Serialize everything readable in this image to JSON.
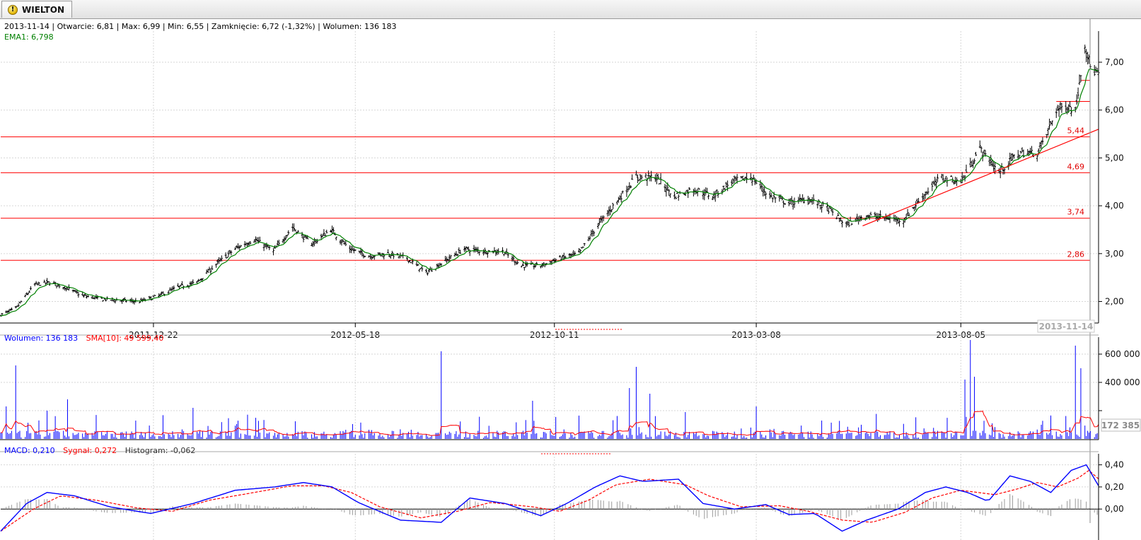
{
  "tab": {
    "title": "WIELTON",
    "icon": "warning-icon"
  },
  "header": {
    "quote": "2013-11-14 | Otwarcie: 6,81 | Max: 6,99 | Min: 6,55 | Zamknięcie: 6,72 (-1,32%)   | Wolumen: 136 183",
    "ema": "EMA1: 6,798"
  },
  "volume_panel": {
    "label": "Wolumen: 136 183",
    "sma": "SMA[10]: 49 599,40",
    "marker": "172 385"
  },
  "macd_panel": {
    "macd": "MACD: 0,210",
    "signal": "Sygnał: 0,272",
    "histogram": "Histogram: -0,062"
  },
  "colors": {
    "price_bar": "#000000",
    "ema": "#008000",
    "level_line": "#ff0000",
    "volume_bar": "#0000ff",
    "sma": "#ff0000",
    "macd": "#0000ff",
    "signal": "#ff0000",
    "histogram": "#9a9a9a"
  },
  "chart_data": [
    {
      "type": "ohlc",
      "title": "",
      "x_tick_labels": [
        "2011-12-22",
        "2012-05-18",
        "2012-10-11",
        "2013-03-08",
        "2013-08-05"
      ],
      "cursor_date": "2013-11-14",
      "y_ticks": [
        2.0,
        3.0,
        4.0,
        5.0,
        6.0,
        7.0
      ],
      "y_tick_labels": [
        "2,00",
        "3,00",
        "4,00",
        "5,00",
        "6,00",
        "7,00"
      ],
      "ylim": [
        1.55,
        7.65
      ],
      "x_range": [
        "2011-09-01",
        "2013-11-14"
      ],
      "close_path": [
        [
          "2011-09-01",
          1.72
        ],
        [
          "2011-09-12",
          1.85
        ],
        [
          "2011-09-26",
          2.35
        ],
        [
          "2011-10-07",
          2.4
        ],
        [
          "2011-10-18",
          2.3
        ],
        [
          "2011-10-31",
          2.12
        ],
        [
          "2011-11-14",
          2.05
        ],
        [
          "2011-11-28",
          2.02
        ],
        [
          "2011-12-12",
          2.0
        ],
        [
          "2011-12-26",
          2.12
        ],
        [
          "2012-01-09",
          2.3
        ],
        [
          "2012-01-23",
          2.4
        ],
        [
          "2012-02-06",
          2.78
        ],
        [
          "2012-02-20",
          3.1
        ],
        [
          "2012-03-05",
          3.3
        ],
        [
          "2012-03-19",
          3.05
        ],
        [
          "2012-04-02",
          3.55
        ],
        [
          "2012-04-16",
          3.2
        ],
        [
          "2012-04-30",
          3.5
        ],
        [
          "2012-05-14",
          3.1
        ],
        [
          "2012-05-28",
          2.95
        ],
        [
          "2012-06-11",
          3.0
        ],
        [
          "2012-06-25",
          2.9
        ],
        [
          "2012-07-09",
          2.6
        ],
        [
          "2012-07-23",
          2.85
        ],
        [
          "2012-08-06",
          3.1
        ],
        [
          "2012-08-20",
          3.05
        ],
        [
          "2012-09-03",
          3.05
        ],
        [
          "2012-09-17",
          2.75
        ],
        [
          "2012-10-01",
          2.75
        ],
        [
          "2012-10-15",
          2.9
        ],
        [
          "2012-10-29",
          3.0
        ],
        [
          "2012-11-12",
          3.6
        ],
        [
          "2012-11-26",
          4.1
        ],
        [
          "2012-12-10",
          4.6
        ],
        [
          "2012-12-24",
          4.6
        ],
        [
          "2013-01-07",
          4.2
        ],
        [
          "2013-01-21",
          4.35
        ],
        [
          "2013-02-04",
          4.2
        ],
        [
          "2013-02-18",
          4.5
        ],
        [
          "2013-03-04",
          4.6
        ],
        [
          "2013-03-18",
          4.2
        ],
        [
          "2013-04-01",
          4.05
        ],
        [
          "2013-04-15",
          4.15
        ],
        [
          "2013-04-29",
          3.95
        ],
        [
          "2013-05-13",
          3.6
        ],
        [
          "2013-05-27",
          3.8
        ],
        [
          "2013-06-10",
          3.75
        ],
        [
          "2013-06-24",
          3.7
        ],
        [
          "2013-07-08",
          4.2
        ],
        [
          "2013-07-22",
          4.6
        ],
        [
          "2013-08-05",
          4.5
        ],
        [
          "2013-08-19",
          5.2
        ],
        [
          "2013-09-02",
          4.7
        ],
        [
          "2013-09-16",
          5.1
        ],
        [
          "2013-09-30",
          5.1
        ],
        [
          "2013-10-07",
          5.5
        ],
        [
          "2013-10-14",
          6.0
        ],
        [
          "2013-10-21",
          6.1
        ],
        [
          "2013-10-28",
          6.0
        ],
        [
          "2013-11-04",
          7.4
        ],
        [
          "2013-11-08",
          6.9
        ],
        [
          "2013-11-14",
          6.72
        ]
      ],
      "ema_label": "EMA1: 6,798",
      "horizontal_levels": [
        {
          "value": 2.86,
          "label": "2,86"
        },
        {
          "value": 3.74,
          "label": "3,74"
        },
        {
          "value": 4.69,
          "label": "4,69"
        },
        {
          "value": 5.44,
          "label": "5,44"
        },
        {
          "value": 6.18,
          "label": ""
        },
        {
          "value": 6.62,
          "label": ""
        }
      ],
      "trendline": [
        [
          "2013-05-25",
          3.58
        ],
        [
          "2013-11-14",
          5.6
        ]
      ]
    },
    {
      "type": "bar",
      "title": "Wolumen: 136 183",
      "series_names": [
        "Wolumen",
        "SMA[10]"
      ],
      "y_ticks": [
        200000,
        400000,
        600000
      ],
      "y_tick_labels": [
        "",
        "400 000",
        "600 000"
      ],
      "ylim": [
        0,
        720000
      ],
      "last_value": 172385,
      "spikes": [
        [
          "2011-09-05",
          230000
        ],
        [
          "2011-09-12",
          520000
        ],
        [
          "2011-10-05",
          200000
        ],
        [
          "2011-10-20",
          280000
        ],
        [
          "2012-01-20",
          220000
        ],
        [
          "2012-07-20",
          620000
        ],
        [
          "2012-09-25",
          270000
        ],
        [
          "2012-12-05",
          360000
        ],
        [
          "2012-12-10",
          510000
        ],
        [
          "2012-12-20",
          320000
        ],
        [
          "2013-01-15",
          190000
        ],
        [
          "2013-03-08",
          230000
        ],
        [
          "2013-08-08",
          420000
        ],
        [
          "2013-08-12",
          700000
        ],
        [
          "2013-08-15",
          440000
        ],
        [
          "2013-10-28",
          660000
        ],
        [
          "2013-11-01",
          500000
        ],
        [
          "2013-11-14",
          172385
        ]
      ],
      "sma_level": 60000
    },
    {
      "type": "line",
      "title": "MACD: 0,210",
      "series_names": [
        "MACD",
        "Sygnał",
        "Histogram"
      ],
      "y_ticks": [
        0.0,
        0.2,
        0.4
      ],
      "y_tick_labels": [
        "0,00",
        "0,20",
        "0,40"
      ],
      "ylim": [
        -0.28,
        0.5
      ],
      "macd": [
        [
          "2011-09-01",
          -0.2
        ],
        [
          "2011-09-20",
          0.05
        ],
        [
          "2011-10-05",
          0.15
        ],
        [
          "2011-10-25",
          0.12
        ],
        [
          "2011-11-20",
          0.02
        ],
        [
          "2011-12-20",
          -0.04
        ],
        [
          "2012-01-20",
          0.05
        ],
        [
          "2012-02-20",
          0.17
        ],
        [
          "2012-03-20",
          0.2
        ],
        [
          "2012-04-10",
          0.24
        ],
        [
          "2012-05-01",
          0.2
        ],
        [
          "2012-05-20",
          0.06
        ],
        [
          "2012-06-20",
          -0.1
        ],
        [
          "2012-07-20",
          -0.12
        ],
        [
          "2012-08-10",
          0.1
        ],
        [
          "2012-09-05",
          0.05
        ],
        [
          "2012-10-01",
          -0.06
        ],
        [
          "2012-10-20",
          0.05
        ],
        [
          "2012-11-10",
          0.2
        ],
        [
          "2012-11-28",
          0.3
        ],
        [
          "2012-12-15",
          0.25
        ],
        [
          "2013-01-10",
          0.27
        ],
        [
          "2013-01-28",
          0.05
        ],
        [
          "2013-02-20",
          0.0
        ],
        [
          "2013-03-15",
          0.04
        ],
        [
          "2013-04-01",
          -0.05
        ],
        [
          "2013-04-20",
          -0.04
        ],
        [
          "2013-05-10",
          -0.2
        ],
        [
          "2013-05-28",
          -0.1
        ],
        [
          "2013-06-20",
          0.0
        ],
        [
          "2013-07-10",
          0.15
        ],
        [
          "2013-07-25",
          0.2
        ],
        [
          "2013-08-10",
          0.15
        ],
        [
          "2013-08-25",
          0.07
        ],
        [
          "2013-09-10",
          0.3
        ],
        [
          "2013-09-25",
          0.25
        ],
        [
          "2013-10-10",
          0.15
        ],
        [
          "2013-10-25",
          0.35
        ],
        [
          "2013-11-05",
          0.4
        ],
        [
          "2013-11-14",
          0.21
        ]
      ],
      "signal": [
        [
          "2011-09-01",
          -0.2
        ],
        [
          "2011-09-25",
          0.0
        ],
        [
          "2011-10-15",
          0.12
        ],
        [
          "2011-11-10",
          0.08
        ],
        [
          "2011-12-10",
          0.01
        ],
        [
          "2012-01-05",
          -0.02
        ],
        [
          "2012-02-01",
          0.08
        ],
        [
          "2012-03-05",
          0.15
        ],
        [
          "2012-04-01",
          0.21
        ],
        [
          "2012-04-25",
          0.21
        ],
        [
          "2012-05-15",
          0.15
        ],
        [
          "2012-06-05",
          0.02
        ],
        [
          "2012-07-05",
          -0.08
        ],
        [
          "2012-08-01",
          -0.02
        ],
        [
          "2012-08-25",
          0.06
        ],
        [
          "2012-09-25",
          0.02
        ],
        [
          "2012-10-15",
          -0.02
        ],
        [
          "2012-11-05",
          0.08
        ],
        [
          "2012-11-25",
          0.22
        ],
        [
          "2012-12-20",
          0.27
        ],
        [
          "2013-01-15",
          0.22
        ],
        [
          "2013-02-01",
          0.12
        ],
        [
          "2013-02-25",
          0.02
        ],
        [
          "2013-03-25",
          0.03
        ],
        [
          "2013-04-15",
          -0.02
        ],
        [
          "2013-05-10",
          -0.1
        ],
        [
          "2013-06-01",
          -0.12
        ],
        [
          "2013-06-25",
          -0.03
        ],
        [
          "2013-07-15",
          0.1
        ],
        [
          "2013-08-05",
          0.17
        ],
        [
          "2013-08-30",
          0.13
        ],
        [
          "2013-09-15",
          0.18
        ],
        [
          "2013-09-30",
          0.24
        ],
        [
          "2013-10-15",
          0.2
        ],
        [
          "2013-10-30",
          0.28
        ],
        [
          "2013-11-07",
          0.35
        ],
        [
          "2013-11-14",
          0.272
        ]
      ],
      "histogram_last": -0.062
    }
  ]
}
